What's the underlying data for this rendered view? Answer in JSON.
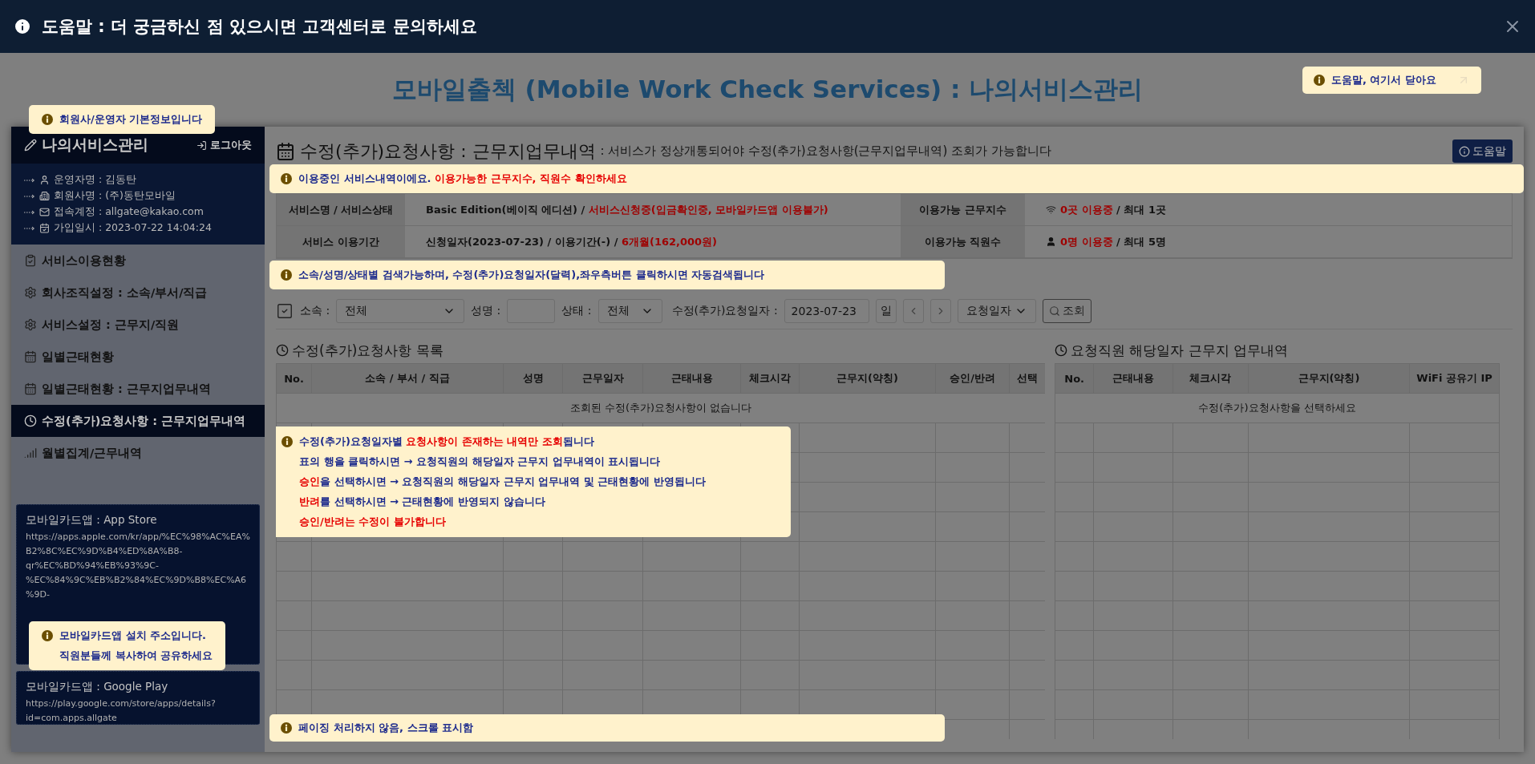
{
  "help_bar": {
    "title": "도움말 : 더 궁금하신 점 있으시면 고객센터로 문의하세요"
  },
  "page_title": "모바일출첵 (Mobile Work Check Services) : 나의서비스관리",
  "callouts": {
    "close": {
      "lines": [
        [
          {
            "text": "도움말, 여기서 닫아요",
            "kind": "normal"
          }
        ]
      ]
    },
    "member": {
      "lines": [
        [
          {
            "text": "회원사/운영자 기본정보입니다",
            "kind": "normal"
          }
        ]
      ]
    },
    "service": {
      "lines": [
        [
          {
            "text": "이용중인 서비스내역이에요. ",
            "kind": "normal"
          },
          {
            "text": "이용가능한 근무지수, 직원수 확인하세요",
            "kind": "highlight"
          }
        ]
      ]
    },
    "search": {
      "lines": [
        [
          {
            "text": "소속/성명/상태별 검색가능하며, 수정(추가)요청일자(달력),좌우측버튼 클릭하시면 자동검색됩니다",
            "kind": "normal"
          }
        ]
      ]
    },
    "list": {
      "lines": [
        [
          {
            "text": "수정(추가)요청일자별 ",
            "kind": "normal"
          },
          {
            "text": "요청사항이 존재하는 내역만 조회",
            "kind": "highlight"
          },
          {
            "text": "됩니다",
            "kind": "normal"
          }
        ],
        [
          {
            "text": "표의 행을 클릭하시면 → 요청직원의 해당일자 근무지 업무내역이 표시됩니다",
            "kind": "normal"
          }
        ],
        [
          {
            "text": "승인",
            "kind": "highlight"
          },
          {
            "text": "을 선택하시면 → 요청직원의 해당일자 근무지 업무내역 및 근태현황에 반영됩니다",
            "kind": "normal"
          }
        ],
        [
          {
            "text": "반려",
            "kind": "highlight"
          },
          {
            "text": "를 선택하시면 → 근태현황에 반영되지 않습니다",
            "kind": "normal"
          }
        ],
        [
          {
            "text": "승인/반려는 수정이 불가합니다",
            "kind": "highlight"
          }
        ]
      ]
    },
    "app": {
      "lines": [
        [
          {
            "text": "모바일카드앱 설치 주소입니다.",
            "kind": "normal"
          }
        ],
        [
          {
            "text": "직원분들께 복사하여 공유하세요",
            "kind": "normal"
          }
        ]
      ]
    },
    "paging": {
      "lines": [
        [
          {
            "text": "페이징 처리하지 않음, 스크롤 표시함",
            "kind": "normal"
          }
        ]
      ]
    }
  },
  "sidebar": {
    "title": "나의서비스관리",
    "logout": "로그아웃",
    "info": [
      {
        "text": "운영자명 : 김동탄",
        "kind": "person"
      },
      {
        "text": "회원사명 : (주)동탄모바일",
        "kind": "building"
      },
      {
        "text": "접속계정 : allgate@kakao.com",
        "kind": "mail"
      },
      {
        "text": "가입일시 : 2023-07-22 14:04:24",
        "kind": "calendar"
      }
    ],
    "menu": [
      {
        "label": "서비스이용현황",
        "kind": "clipboard",
        "selected": false
      },
      {
        "label": "회사조직설정 : 소속/부서/직급",
        "kind": "gear",
        "selected": false
      },
      {
        "label": "서비스설정 : 근무지/직원",
        "kind": "gear",
        "selected": false
      },
      {
        "label": "일별근태현황",
        "kind": "calendar",
        "selected": false
      },
      {
        "label": "일별근태현황 : 근무지업무내역",
        "kind": "calendar",
        "selected": false
      },
      {
        "label": "수정(추가)요청사항 : 근무지업무내역",
        "kind": "clock",
        "selected": true
      },
      {
        "label": "월별집계/근무내역",
        "kind": "chart",
        "selected": false
      }
    ],
    "app_links": [
      {
        "title": "모바일카드앱 : App Store",
        "url": "https://apps.apple.com/kr/app/%EC%98%AC%EA%B2%8C%EC%9D%B4%ED%8A%B8-qr%EC%BD%94%EB%93%9C-%EC%84%9C%EB%B2%84%EC%9D%B8%EC%A6%9D-"
      },
      {
        "title": "모바일카드앱 : Google Play",
        "url": "https://play.google.com/store/apps/details?id=com.apps.allgate"
      }
    ]
  },
  "main": {
    "title": "수정(추가)요청사항 : 근무지업무내역",
    "subtitle": ": 서비스가 정상개통되어야 수정(추가)요청사항(근무지업무내역) 조회가 가능합니다",
    "help_button": "도움말",
    "service_info": [
      {
        "label": "서비스명 / 서비스상태",
        "kind": "plain",
        "value": [
          {
            "text": "Basic Edition(베이직 에디션) / ",
            "kind": "normal"
          },
          {
            "text": "서비스신청중(입금확인중, 모바일카드앱 이용불가)",
            "kind": "alert"
          }
        ]
      },
      {
        "label": "이용가능 근무지수",
        "kind": "wifi",
        "value": [
          {
            "text": "0곳 이용중",
            "kind": "alert"
          },
          {
            "text": " / 최대 1곳",
            "kind": "normal"
          }
        ]
      },
      {
        "label": "서비스 이용기간",
        "kind": "plain",
        "value": [
          {
            "text": "신청일자(2023-07-23) / 이용기간(-) / ",
            "kind": "normal"
          },
          {
            "text": "6개월(162,000원)",
            "kind": "alert"
          }
        ]
      },
      {
        "label": "이용가능 직원수",
        "kind": "person",
        "value": [
          {
            "text": "0명 이용중",
            "kind": "alert"
          },
          {
            "text": " / 최대 5명",
            "kind": "normal"
          }
        ]
      }
    ],
    "filters": {
      "affiliation_label": "소속 :",
      "affiliation": "전체",
      "name_label": "성명 :",
      "status_label": "상태 :",
      "status": "전체",
      "date_label": "수정(추가)요청일자 :",
      "date": "2023-07-23",
      "day_button": "일",
      "sort": "요청일자",
      "search_button": "조회"
    },
    "request_list": {
      "title": "수정(추가)요청사항 목록",
      "columns": [
        "No.",
        "소속 / 부서 / 직급",
        "성명",
        "근무일자",
        "근태내용",
        "체크시각",
        "근무지(약칭)",
        "승인/반려",
        "선택"
      ],
      "empty_message": "조회된 수정(추가)요청사항이 없습니다"
    },
    "detail": {
      "title": "요청직원 해당일자 근무지 업무내역",
      "columns": [
        "No.",
        "근태내용",
        "체크시각",
        "근무지(약칭)",
        "WiFi 공유기 IP"
      ],
      "empty_message": "수정(추가)요청사항을 선택하세요"
    }
  }
}
